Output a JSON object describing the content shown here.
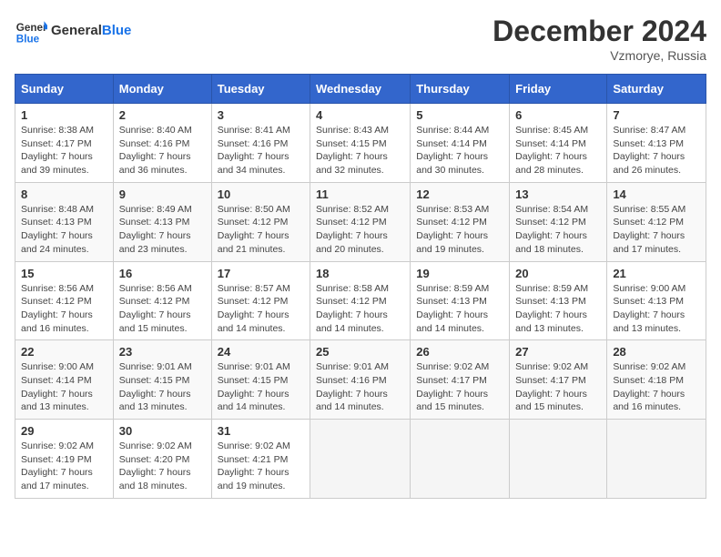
{
  "header": {
    "logo_general": "General",
    "logo_blue": "Blue",
    "month_title": "December 2024",
    "location": "Vzmorye, Russia"
  },
  "days_of_week": [
    "Sunday",
    "Monday",
    "Tuesday",
    "Wednesday",
    "Thursday",
    "Friday",
    "Saturday"
  ],
  "weeks": [
    [
      {
        "day": "1",
        "sunrise": "Sunrise: 8:38 AM",
        "sunset": "Sunset: 4:17 PM",
        "daylight": "Daylight: 7 hours and 39 minutes."
      },
      {
        "day": "2",
        "sunrise": "Sunrise: 8:40 AM",
        "sunset": "Sunset: 4:16 PM",
        "daylight": "Daylight: 7 hours and 36 minutes."
      },
      {
        "day": "3",
        "sunrise": "Sunrise: 8:41 AM",
        "sunset": "Sunset: 4:16 PM",
        "daylight": "Daylight: 7 hours and 34 minutes."
      },
      {
        "day": "4",
        "sunrise": "Sunrise: 8:43 AM",
        "sunset": "Sunset: 4:15 PM",
        "daylight": "Daylight: 7 hours and 32 minutes."
      },
      {
        "day": "5",
        "sunrise": "Sunrise: 8:44 AM",
        "sunset": "Sunset: 4:14 PM",
        "daylight": "Daylight: 7 hours and 30 minutes."
      },
      {
        "day": "6",
        "sunrise": "Sunrise: 8:45 AM",
        "sunset": "Sunset: 4:14 PM",
        "daylight": "Daylight: 7 hours and 28 minutes."
      },
      {
        "day": "7",
        "sunrise": "Sunrise: 8:47 AM",
        "sunset": "Sunset: 4:13 PM",
        "daylight": "Daylight: 7 hours and 26 minutes."
      }
    ],
    [
      {
        "day": "8",
        "sunrise": "Sunrise: 8:48 AM",
        "sunset": "Sunset: 4:13 PM",
        "daylight": "Daylight: 7 hours and 24 minutes."
      },
      {
        "day": "9",
        "sunrise": "Sunrise: 8:49 AM",
        "sunset": "Sunset: 4:13 PM",
        "daylight": "Daylight: 7 hours and 23 minutes."
      },
      {
        "day": "10",
        "sunrise": "Sunrise: 8:50 AM",
        "sunset": "Sunset: 4:12 PM",
        "daylight": "Daylight: 7 hours and 21 minutes."
      },
      {
        "day": "11",
        "sunrise": "Sunrise: 8:52 AM",
        "sunset": "Sunset: 4:12 PM",
        "daylight": "Daylight: 7 hours and 20 minutes."
      },
      {
        "day": "12",
        "sunrise": "Sunrise: 8:53 AM",
        "sunset": "Sunset: 4:12 PM",
        "daylight": "Daylight: 7 hours and 19 minutes."
      },
      {
        "day": "13",
        "sunrise": "Sunrise: 8:54 AM",
        "sunset": "Sunset: 4:12 PM",
        "daylight": "Daylight: 7 hours and 18 minutes."
      },
      {
        "day": "14",
        "sunrise": "Sunrise: 8:55 AM",
        "sunset": "Sunset: 4:12 PM",
        "daylight": "Daylight: 7 hours and 17 minutes."
      }
    ],
    [
      {
        "day": "15",
        "sunrise": "Sunrise: 8:56 AM",
        "sunset": "Sunset: 4:12 PM",
        "daylight": "Daylight: 7 hours and 16 minutes."
      },
      {
        "day": "16",
        "sunrise": "Sunrise: 8:56 AM",
        "sunset": "Sunset: 4:12 PM",
        "daylight": "Daylight: 7 hours and 15 minutes."
      },
      {
        "day": "17",
        "sunrise": "Sunrise: 8:57 AM",
        "sunset": "Sunset: 4:12 PM",
        "daylight": "Daylight: 7 hours and 14 minutes."
      },
      {
        "day": "18",
        "sunrise": "Sunrise: 8:58 AM",
        "sunset": "Sunset: 4:12 PM",
        "daylight": "Daylight: 7 hours and 14 minutes."
      },
      {
        "day": "19",
        "sunrise": "Sunrise: 8:59 AM",
        "sunset": "Sunset: 4:13 PM",
        "daylight": "Daylight: 7 hours and 14 minutes."
      },
      {
        "day": "20",
        "sunrise": "Sunrise: 8:59 AM",
        "sunset": "Sunset: 4:13 PM",
        "daylight": "Daylight: 7 hours and 13 minutes."
      },
      {
        "day": "21",
        "sunrise": "Sunrise: 9:00 AM",
        "sunset": "Sunset: 4:13 PM",
        "daylight": "Daylight: 7 hours and 13 minutes."
      }
    ],
    [
      {
        "day": "22",
        "sunrise": "Sunrise: 9:00 AM",
        "sunset": "Sunset: 4:14 PM",
        "daylight": "Daylight: 7 hours and 13 minutes."
      },
      {
        "day": "23",
        "sunrise": "Sunrise: 9:01 AM",
        "sunset": "Sunset: 4:15 PM",
        "daylight": "Daylight: 7 hours and 13 minutes."
      },
      {
        "day": "24",
        "sunrise": "Sunrise: 9:01 AM",
        "sunset": "Sunset: 4:15 PM",
        "daylight": "Daylight: 7 hours and 14 minutes."
      },
      {
        "day": "25",
        "sunrise": "Sunrise: 9:01 AM",
        "sunset": "Sunset: 4:16 PM",
        "daylight": "Daylight: 7 hours and 14 minutes."
      },
      {
        "day": "26",
        "sunrise": "Sunrise: 9:02 AM",
        "sunset": "Sunset: 4:17 PM",
        "daylight": "Daylight: 7 hours and 15 minutes."
      },
      {
        "day": "27",
        "sunrise": "Sunrise: 9:02 AM",
        "sunset": "Sunset: 4:17 PM",
        "daylight": "Daylight: 7 hours and 15 minutes."
      },
      {
        "day": "28",
        "sunrise": "Sunrise: 9:02 AM",
        "sunset": "Sunset: 4:18 PM",
        "daylight": "Daylight: 7 hours and 16 minutes."
      }
    ],
    [
      {
        "day": "29",
        "sunrise": "Sunrise: 9:02 AM",
        "sunset": "Sunset: 4:19 PM",
        "daylight": "Daylight: 7 hours and 17 minutes."
      },
      {
        "day": "30",
        "sunrise": "Sunrise: 9:02 AM",
        "sunset": "Sunset: 4:20 PM",
        "daylight": "Daylight: 7 hours and 18 minutes."
      },
      {
        "day": "31",
        "sunrise": "Sunrise: 9:02 AM",
        "sunset": "Sunset: 4:21 PM",
        "daylight": "Daylight: 7 hours and 19 minutes."
      },
      null,
      null,
      null,
      null
    ]
  ]
}
